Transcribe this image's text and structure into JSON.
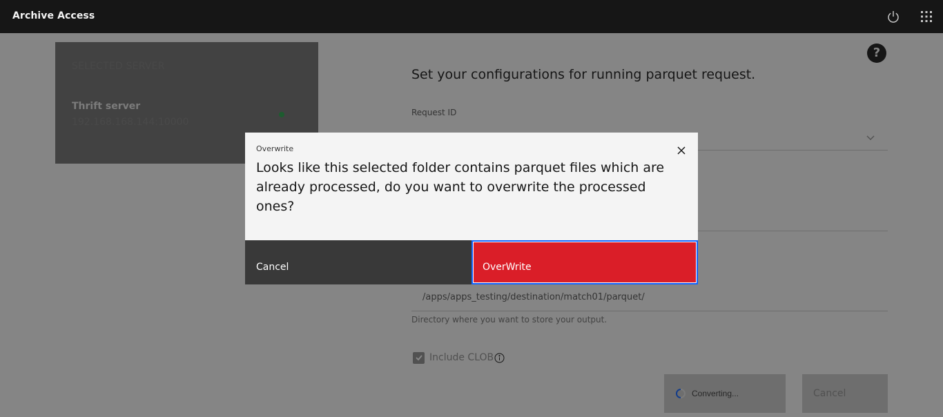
{
  "header": {
    "app_title": "Archive Access",
    "icons": [
      "power-icon",
      "app-switcher-icon"
    ]
  },
  "server": {
    "heading": "SELECTED SERVER",
    "name": "Thrift server",
    "address": "192.168.168.144:10000",
    "status_color": "#24a148"
  },
  "form": {
    "title": "Set your configurations for running parquet request.",
    "request_id_label": "Request ID",
    "request_id_value": "",
    "destination_value": "/apps/apps_testing/destination/match01/parquet/",
    "destination_helper": "Directory where you want to store your output.",
    "include_clob_label": "Include CLOB",
    "include_clob_checked": true,
    "convert_label": "Converting...",
    "cancel_label": "Cancel"
  },
  "modal": {
    "label": "Overwrite",
    "body": "Looks like this selected folder contains parquet files which are already processed, do you want to overwrite the processed ones?",
    "cancel_label": "Cancel",
    "overwrite_label": "OverWrite"
  },
  "colors": {
    "header_bg": "#161616",
    "danger": "#da1e28",
    "focus": "#0f62fe",
    "secondary_btn": "#393939"
  }
}
